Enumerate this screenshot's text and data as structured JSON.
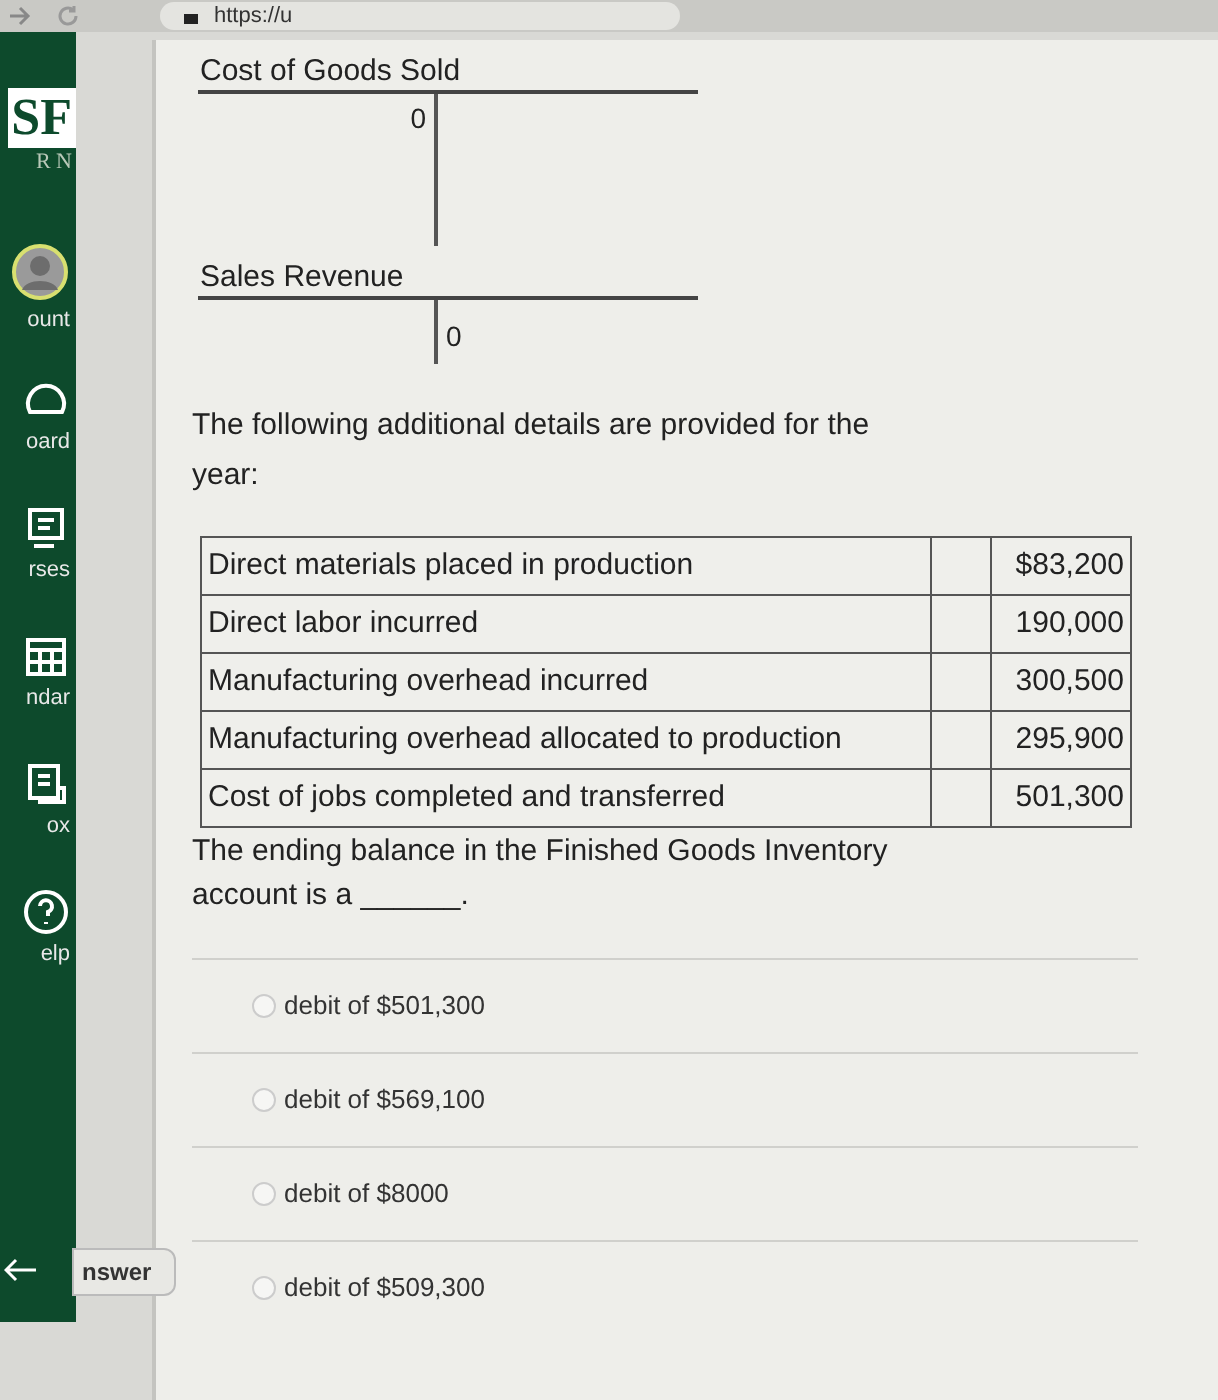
{
  "browser": {
    "url": "https://u"
  },
  "sidebar": {
    "logo": {
      "text": "SF",
      "subtitle": "R N"
    },
    "items": [
      {
        "kind": "account",
        "label": "ount"
      },
      {
        "kind": "dashboard",
        "label": "oard"
      },
      {
        "kind": "courses",
        "label": "rses"
      },
      {
        "kind": "calendar",
        "label": "ndar"
      },
      {
        "kind": "inbox",
        "label": "ox"
      },
      {
        "kind": "help",
        "label": "elp"
      }
    ]
  },
  "answer_tab": {
    "label": "nswer"
  },
  "t_accounts": [
    {
      "title": "Cost of Goods Sold",
      "debit": "0",
      "tall": true
    },
    {
      "title": "Sales Revenue",
      "credit": "0",
      "tall": false
    }
  ],
  "intro": "The following additional details are provided for the year:",
  "table": {
    "rows": [
      {
        "label": "Direct materials placed in production",
        "amount": "$83,200"
      },
      {
        "label": "Direct labor incurred",
        "amount": "190,000"
      },
      {
        "label": "Manufacturing overhead incurred",
        "amount": "300,500"
      },
      {
        "label": "Manufacturing overhead allocated to production",
        "amount": "295,900"
      },
      {
        "label": "Cost of jobs completed and transferred",
        "amount": "501,300"
      }
    ]
  },
  "question": {
    "text": "The ending balance in the Finished Goods Inventory account is a",
    "blank": "______."
  },
  "options": [
    {
      "label": "debit of $501,300",
      "selected": false
    },
    {
      "label": "debit of $569,100",
      "selected": false
    },
    {
      "label": "debit of $8000",
      "selected": false
    },
    {
      "label": "debit of $509,300",
      "selected": false
    }
  ]
}
